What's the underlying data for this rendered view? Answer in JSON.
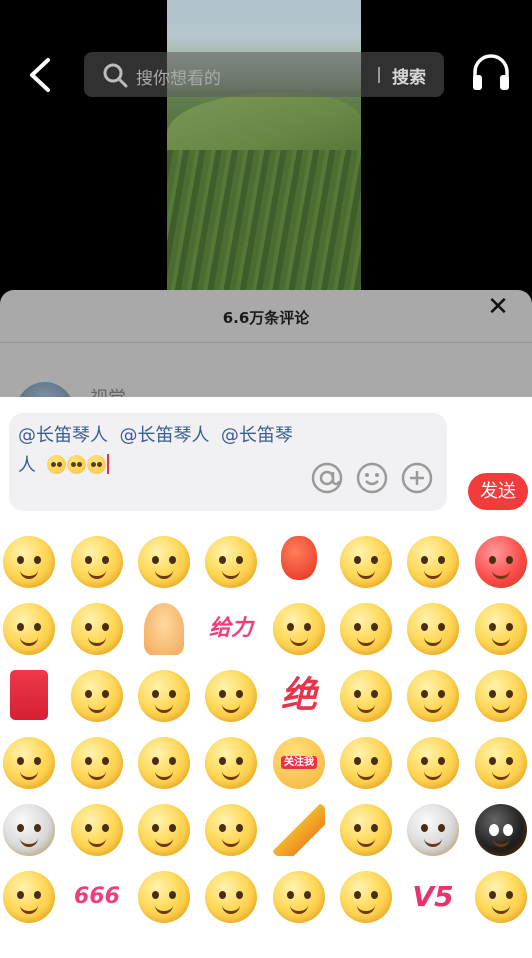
{
  "search": {
    "placeholder": "搜你想看的",
    "button": "搜索"
  },
  "comments": {
    "title": "6.6万条评论",
    "preview_user": "视觉"
  },
  "input": {
    "mentions": [
      "@长笛琴人",
      "@长笛琴人",
      "@长笛琴"
    ],
    "continuation": "人",
    "emoji_count": 3
  },
  "send_label": "发送",
  "stickers": {
    "geili": "给力",
    "jue": "绝",
    "follow": "关注我",
    "six": "666",
    "v5": "V5"
  },
  "colors": {
    "accent": "#f23b3b",
    "mention": "#3c5d92"
  },
  "emojis": [
    [
      "finger-on-lips-icon",
      "sunglasses-cool-icon",
      "slipper-icon",
      "grin-laugh-icon",
      "lantern-icon",
      "sunglasses-smirk-icon",
      "tear-mouth-icon",
      "angry-red-icon"
    ],
    [
      "headband-fighting-icon",
      "sweat-smile-icon",
      "pray-hands-icon",
      "geili-sticker",
      "clapping-icon",
      "shy-smile-icon",
      "grin-icon",
      "yawn-icon"
    ],
    [
      "red-envelope-icon",
      "teeth-grin-icon",
      "smug-icon",
      "thinking-icon",
      "jue-sticker",
      "puppy-eyes-icon",
      "shocked-icon",
      "whistle-icon"
    ],
    [
      "dizzy-icon",
      "teary-icon",
      "laugh-cry-icon",
      "unamused-icon",
      "follow-me-sticker",
      "cry-eyes-up-icon",
      "skeptical-icon",
      "crying-icon"
    ],
    [
      "mahjong-tile-icon",
      "side-eye-icon",
      "starstruck-icon",
      "cover-mouth-icon",
      "party-popper-icon",
      "heart-eyes-icon",
      "ghost-shock-icon",
      "black-face-icon"
    ],
    [
      "hmm-icon",
      "666-sticker",
      "heart-hug-icon",
      "tongue-wink-icon",
      "giggle-icon",
      "blood-spit-icon",
      "v5-sticker",
      "beam-icon"
    ]
  ]
}
